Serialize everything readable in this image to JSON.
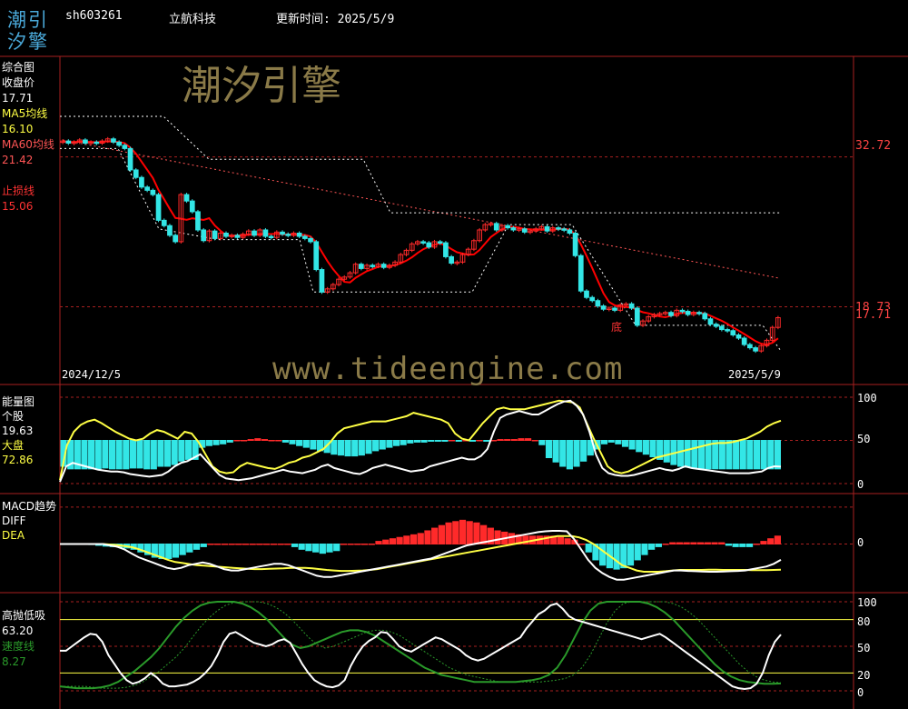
{
  "header": {
    "logo_top": "潮引",
    "logo_bottom": "汐擎",
    "code": "sh603261",
    "name": "立航科技",
    "update_label": "更新时间:",
    "update_value": "2025/5/9"
  },
  "watermark": {
    "brand": "潮汐引擎",
    "url": "www.tideengine.com"
  },
  "colors": {
    "bg": "#000000",
    "up": "#ff2a2a",
    "down": "#33e6e6",
    "ma5": "#ff0000",
    "ma60": "#ff5555",
    "yellow": "#ffff44",
    "white": "#ffffff",
    "green": "#2a9a2a",
    "grid": "#a82020"
  },
  "chart_data": [
    {
      "type": "candlestick",
      "title": "综合图",
      "legend": [
        {
          "name": "收盘价",
          "value": "17.71",
          "color": "#ffffff"
        },
        {
          "name": "MA5均线",
          "value": "16.10",
          "color": "#ffff44"
        },
        {
          "name": "MA60均线",
          "value": "21.42",
          "color": "#ff5555"
        },
        {
          "name": "止损线",
          "value": "15.06",
          "color": "#ff3333"
        }
      ],
      "y_ticks": [
        "32.72",
        "18.73"
      ],
      "last_price_label": "17.71",
      "annotation": "底",
      "date_start": "2024/12/5",
      "date_end": "2025/5/9",
      "ylim": [
        13,
        41
      ],
      "close": [
        34.2,
        34.0,
        34.1,
        34.3,
        34.0,
        34.1,
        34.0,
        34.2,
        34.4,
        34.1,
        33.8,
        33.5,
        31.5,
        30.8,
        29.9,
        29.6,
        29.2,
        26.8,
        26.3,
        25.4,
        24.8,
        29.2,
        28.6,
        27.6,
        25.9,
        24.9,
        25.8,
        25.1,
        25.6,
        25.3,
        25.4,
        25.2,
        25.5,
        25.8,
        25.4,
        25.9,
        25.3,
        25.2,
        25.7,
        25.5,
        25.4,
        25.6,
        25.3,
        25.1,
        24.8,
        22.2,
        20.1,
        20.4,
        20.8,
        21.3,
        21.5,
        21.9,
        22.7,
        22.3,
        22.6,
        22.5,
        22.7,
        22.4,
        22.6,
        22.9,
        23.6,
        24.0,
        24.6,
        24.8,
        24.7,
        24.3,
        24.8,
        24.7,
        23.4,
        22.8,
        22.9,
        23.6,
        24.1,
        24.9,
        25.9,
        26.4,
        26.5,
        25.9,
        26.3,
        26.1,
        25.9,
        26.0,
        25.7,
        25.8,
        26.0,
        26.2,
        25.8,
        26.1,
        26.0,
        25.9,
        25.6,
        23.5,
        20.2,
        19.6,
        19.3,
        18.8,
        18.5,
        18.6,
        18.4,
        18.9,
        19.0,
        18.6,
        17.0,
        17.4,
        17.8,
        18.0,
        18.1,
        18.2,
        17.9,
        18.4,
        18.3,
        18.0,
        18.2,
        18.1,
        17.6,
        17.1,
        16.9,
        16.6,
        16.5,
        16.1,
        15.8,
        15.2,
        14.9,
        14.6,
        15.1,
        15.6,
        16.8,
        17.71
      ]
    },
    {
      "type": "bar+line",
      "title": "能量图",
      "legend": [
        {
          "name": "个股",
          "value": "19.63",
          "color": "#ffffff"
        },
        {
          "name": "大盘",
          "value": "72.86",
          "color": "#ffff44"
        }
      ],
      "y_ticks": [
        "100",
        "50",
        "0"
      ],
      "ylim": [
        0,
        100
      ],
      "series": [
        {
          "name": "个股",
          "values": [
            2,
            20,
            24,
            22,
            20,
            18,
            16,
            15,
            14,
            14,
            13,
            11,
            10,
            9,
            8,
            9,
            10,
            14,
            20,
            24,
            26,
            30,
            34,
            26,
            18,
            10,
            6,
            5,
            4,
            5,
            6,
            8,
            10,
            12,
            14,
            16,
            14,
            13,
            12,
            14,
            16,
            20,
            22,
            18,
            16,
            14,
            12,
            11,
            14,
            18,
            20,
            22,
            20,
            18,
            16,
            14,
            15,
            16,
            20,
            22,
            24,
            26,
            28,
            30,
            28,
            28,
            32,
            40,
            60,
            76,
            80,
            82,
            84,
            82,
            80,
            80,
            84,
            88,
            92,
            95,
            96,
            90,
            80,
            60,
            34,
            18,
            12,
            10,
            9,
            9,
            10,
            12,
            14,
            16,
            18,
            16,
            15,
            17,
            20,
            18,
            17,
            16,
            15,
            14,
            13,
            12,
            12,
            12,
            12,
            13,
            14,
            18,
            20,
            19.63
          ]
        },
        {
          "name": "大盘",
          "values": [
            4,
            44,
            60,
            68,
            72,
            74,
            70,
            65,
            60,
            56,
            52,
            50,
            52,
            58,
            62,
            60,
            56,
            52,
            60,
            58,
            48,
            34,
            20,
            14,
            12,
            13,
            20,
            24,
            22,
            20,
            18,
            17,
            20,
            24,
            26,
            30,
            32,
            36,
            40,
            48,
            58,
            64,
            66,
            68,
            70,
            72,
            72,
            72,
            74,
            76,
            78,
            82,
            80,
            78,
            76,
            74,
            70,
            58,
            52,
            50,
            60,
            70,
            78,
            86,
            88,
            86,
            86,
            86,
            88,
            90,
            92,
            94,
            96,
            95,
            94,
            88,
            70,
            52,
            36,
            20,
            14,
            12,
            14,
            18,
            22,
            26,
            30,
            32,
            34,
            36,
            38,
            40,
            42,
            44,
            46,
            47,
            47,
            48,
            50,
            52,
            56,
            60,
            66,
            70,
            72.86
          ]
        },
        {
          "name": "柱",
          "values": [
            -30,
            -33,
            -33,
            -33,
            -33,
            -33,
            -32,
            -33,
            -33,
            -33,
            -32,
            -32,
            -33,
            -33,
            -30,
            -30,
            -28,
            -24,
            -22,
            -22,
            -8,
            -6,
            -5,
            -4,
            -2,
            0,
            0,
            1,
            2,
            1,
            0,
            0,
            -2,
            -4,
            -6,
            -8,
            -10,
            -12,
            -14,
            -16,
            -17,
            -18,
            -18,
            -17,
            -15,
            -12,
            -10,
            -8,
            -6,
            -5,
            -3,
            -2,
            -2,
            -1,
            -1,
            -1,
            0,
            -1,
            0,
            -1,
            0,
            -1,
            0,
            1,
            1,
            1,
            2,
            2,
            0,
            -5,
            -20,
            -25,
            -30,
            -33,
            -30,
            -24,
            -17,
            -10,
            -4,
            -2,
            -4,
            -7,
            -10,
            -13,
            -16,
            -19,
            -22,
            -25,
            -28,
            -30,
            -31,
            -32,
            -33,
            -33,
            -33,
            -33,
            -33,
            -33,
            -33,
            -33,
            -33,
            -33,
            -33,
            -33
          ]
        }
      ]
    },
    {
      "type": "bar+line",
      "title": "MACD趋势",
      "legend": [
        {
          "name": "DIFF",
          "value": "",
          "color": "#ffffff"
        },
        {
          "name": "DEA",
          "value": "",
          "color": "#ffff44"
        }
      ],
      "y_ticks": [
        "0"
      ],
      "ylim": [
        -1.6,
        1.6
      ],
      "series": [
        {
          "name": "DIFF",
          "values": [
            0,
            0,
            0,
            0,
            0,
            0,
            0,
            -0.05,
            -0.1,
            -0.2,
            -0.35,
            -0.5,
            -0.6,
            -0.7,
            -0.8,
            -0.9,
            -0.95,
            -0.9,
            -0.8,
            -0.75,
            -0.7,
            -0.75,
            -0.85,
            -0.95,
            -1.0,
            -1.0,
            -0.95,
            -0.9,
            -0.85,
            -0.8,
            -0.75,
            -0.75,
            -0.8,
            -0.9,
            -1.0,
            -1.1,
            -1.2,
            -1.25,
            -1.25,
            -1.2,
            -1.15,
            -1.1,
            -1.05,
            -1.0,
            -0.95,
            -0.9,
            -0.85,
            -0.8,
            -0.75,
            -0.7,
            -0.65,
            -0.6,
            -0.55,
            -0.45,
            -0.35,
            -0.25,
            -0.15,
            -0.05,
            0,
            0.05,
            0.1,
            0.15,
            0.2,
            0.25,
            0.3,
            0.35,
            0.4,
            0.45,
            0.48,
            0.5,
            0.5,
            0.48,
            0.2,
            -0.2,
            -0.6,
            -0.9,
            -1.1,
            -1.25,
            -1.35,
            -1.35,
            -1.3,
            -1.25,
            -1.2,
            -1.15,
            -1.1,
            -1.05,
            -1.0,
            -1.0,
            -1.02,
            -1.03,
            -1.04,
            -1.05,
            -1.05,
            -1.04,
            -1.03,
            -1.02,
            -1.0,
            -0.95,
            -0.9,
            -0.85,
            -0.75,
            -0.6
          ]
        },
        {
          "name": "DEA",
          "values": [
            0,
            0,
            0,
            0,
            0,
            0,
            0,
            -0.02,
            -0.04,
            -0.08,
            -0.12,
            -0.2,
            -0.3,
            -0.4,
            -0.5,
            -0.6,
            -0.68,
            -0.72,
            -0.76,
            -0.8,
            -0.82,
            -0.84,
            -0.86,
            -0.88,
            -0.9,
            -0.92,
            -0.94,
            -0.95,
            -0.95,
            -0.94,
            -0.93,
            -0.92,
            -0.9,
            -0.9,
            -0.9,
            -0.92,
            -0.95,
            -0.98,
            -1.0,
            -1.02,
            -1.02,
            -1.01,
            -1.0,
            -0.98,
            -0.95,
            -0.9,
            -0.85,
            -0.8,
            -0.75,
            -0.7,
            -0.65,
            -0.6,
            -0.55,
            -0.5,
            -0.45,
            -0.4,
            -0.35,
            -0.3,
            -0.25,
            -0.2,
            -0.15,
            -0.1,
            -0.05,
            0,
            0.05,
            0.1,
            0.15,
            0.2,
            0.25,
            0.3,
            0.3,
            0.3,
            0.25,
            0.15,
            0,
            -0.2,
            -0.4,
            -0.6,
            -0.8,
            -0.9,
            -1.0,
            -1.05,
            -1.05,
            -1.05,
            -1.03,
            -1.0,
            -0.98,
            -0.98,
            -0.98,
            -0.98,
            -0.97,
            -0.97,
            -0.98,
            -0.98,
            -0.98,
            -0.98,
            -0.99,
            -0.99,
            -0.99,
            -0.98,
            -0.97
          ]
        },
        {
          "name": "MACD",
          "values": [
            0,
            0,
            0,
            0,
            -0.02,
            -0.05,
            -0.08,
            -0.1,
            -0.12,
            -0.15,
            -0.2,
            -0.3,
            -0.4,
            -0.5,
            -0.55,
            -0.55,
            -0.5,
            -0.4,
            -0.3,
            -0.2,
            -0.1,
            0,
            0,
            0,
            0,
            0,
            0,
            0,
            0,
            0,
            0,
            0,
            0,
            -0.1,
            -0.2,
            -0.25,
            -0.3,
            -0.35,
            -0.3,
            -0.25,
            0,
            0,
            0,
            0,
            0,
            0.1,
            0.15,
            0.2,
            0.25,
            0.3,
            0.35,
            0.4,
            0.5,
            0.6,
            0.7,
            0.8,
            0.85,
            0.9,
            0.85,
            0.8,
            0.7,
            0.6,
            0.5,
            0.45,
            0.4,
            0.35,
            0.3,
            0.3,
            0.3,
            0.3,
            0.3,
            0.25,
            0.2,
            0.15,
            0,
            -0.3,
            -0.6,
            -0.8,
            -0.9,
            -0.95,
            -0.9,
            -0.8,
            -0.6,
            -0.4,
            -0.2,
            -0.1,
            0,
            0.05,
            0.05,
            0.05,
            0.05,
            0.05,
            0.05,
            0.05,
            0.05,
            -0.05,
            -0.1,
            -0.1,
            -0.1,
            0,
            0.1,
            0.2,
            0.3
          ]
        }
      ]
    },
    {
      "type": "line",
      "title": "高抛低吸",
      "legend": [
        {
          "name": "",
          "value": "63.20",
          "color": "#ffffff"
        },
        {
          "name": "速度线",
          "value": "8.27",
          "color": "#2a9a2a"
        }
      ],
      "y_ticks": [
        "100",
        "80",
        "50",
        "20",
        "0"
      ],
      "ylim": [
        0,
        100
      ],
      "series": [
        {
          "name": "白线",
          "values": [
            45,
            45,
            50,
            55,
            60,
            64,
            63,
            55,
            40,
            30,
            20,
            12,
            8,
            10,
            14,
            20,
            15,
            8,
            5,
            5,
            6,
            7,
            10,
            14,
            20,
            28,
            40,
            55,
            64,
            66,
            62,
            58,
            54,
            52,
            50,
            52,
            56,
            58,
            54,
            42,
            30,
            20,
            12,
            8,
            5,
            4,
            6,
            12,
            28,
            40,
            50,
            56,
            60,
            66,
            65,
            58,
            50,
            46,
            44,
            48,
            52,
            56,
            60,
            58,
            54,
            50,
            46,
            40,
            36,
            34,
            36,
            40,
            44,
            48,
            52,
            56,
            60,
            70,
            78,
            86,
            90,
            96,
            98,
            92,
            84,
            80,
            78,
            76,
            74,
            72,
            70,
            68,
            66,
            64,
            62,
            60,
            58,
            60,
            62,
            64,
            60,
            55,
            50,
            45,
            40,
            35,
            30,
            25,
            20,
            15,
            10,
            5,
            3,
            2,
            3,
            8,
            20,
            40,
            55,
            63.2
          ]
        },
        {
          "name": "速度线",
          "values": [
            5,
            4,
            3,
            3,
            3,
            4,
            6,
            10,
            16,
            22,
            30,
            38,
            48,
            60,
            72,
            82,
            90,
            96,
            99,
            100,
            100,
            100,
            98,
            94,
            88,
            80,
            70,
            60,
            52,
            48,
            50,
            54,
            58,
            62,
            66,
            68,
            68,
            66,
            62,
            56,
            50,
            44,
            38,
            32,
            26,
            22,
            18,
            16,
            14,
            12,
            10,
            10,
            10,
            10,
            10,
            10,
            11,
            12,
            14,
            18,
            26,
            40,
            58,
            76,
            90,
            98,
            100,
            100,
            100,
            100,
            100,
            98,
            94,
            88,
            80,
            70,
            60,
            50,
            40,
            30,
            22,
            16,
            12,
            10,
            9,
            8,
            8,
            8.27
          ]
        }
      ]
    }
  ]
}
